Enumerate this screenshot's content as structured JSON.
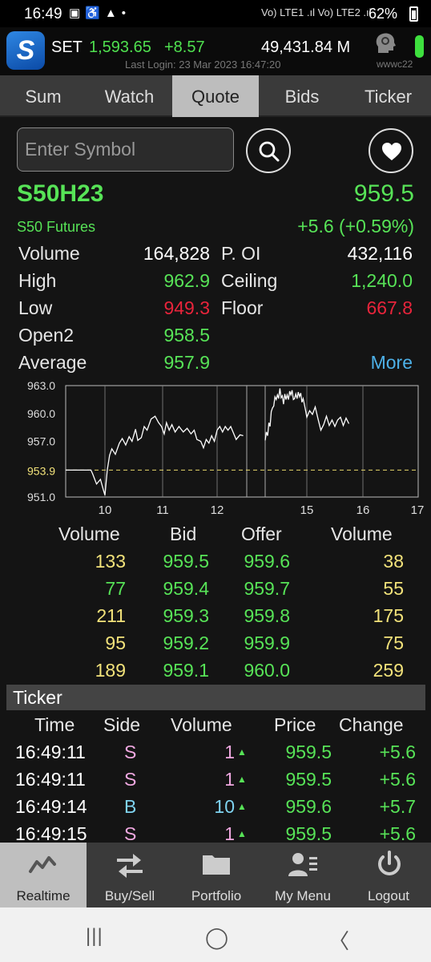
{
  "status_bar": {
    "time": "16:49",
    "notification_icons": [
      "image-icon",
      "accessibility-icon",
      "warning-icon",
      "dot-icon"
    ],
    "network": "Vo) LTE1 .ıl  Vo) LTE2 .ıl",
    "battery": "62%"
  },
  "header": {
    "app_logo": "S",
    "index_name": "SET",
    "index_value": "1,593.65",
    "index_change": "+8.57",
    "turnover": "49,431.84 M",
    "last_login": "Last Login: 23 Mar 2023 16:47:20",
    "username": "wwwc22",
    "connection_color": "#3ee03e"
  },
  "tabs": [
    "Sum",
    "Watch",
    "Quote",
    "Bids",
    "Ticker"
  ],
  "active_tab": "Quote",
  "search": {
    "placeholder": "Enter Symbol"
  },
  "quote": {
    "symbol": "S50H23",
    "name": "S50 Futures",
    "last": "959.5",
    "change": "+5.6 (+0.59%)",
    "volume_label": "Volume",
    "volume": "164,828",
    "poi_label": "P. OI",
    "poi": "432,116",
    "high_label": "High",
    "high": "962.9",
    "ceiling_label": "Ceiling",
    "ceiling": "1,240.0",
    "low_label": "Low",
    "low": "949.3",
    "floor_label": "Floor",
    "floor": "667.8",
    "open2_label": "Open2",
    "open2": "958.5",
    "average_label": "Average",
    "average": "957.9",
    "more_label": "More"
  },
  "chart_data": {
    "type": "line",
    "y_ticks": [
      "963.0",
      "960.0",
      "957.0",
      "951.0"
    ],
    "prior_close": 953.9,
    "prior_close_label": "953.9",
    "x_ticks": [
      "10",
      "11",
      "12",
      "15",
      "16",
      "17"
    ],
    "ylim": [
      951.0,
      963.0
    ],
    "xlim": [
      9.3,
      17.0
    ],
    "grid": true,
    "segments": [
      [
        [
          9.3,
          953.9
        ],
        [
          9.75,
          953.9
        ],
        [
          9.78,
          953.5
        ],
        [
          9.85,
          952.4
        ],
        [
          9.92,
          952.9
        ],
        [
          9.97,
          951.8
        ],
        [
          10.0,
          951.2
        ],
        [
          10.04,
          953.9
        ],
        [
          10.08,
          955.5
        ],
        [
          10.12,
          956.2
        ],
        [
          10.18,
          955.6
        ],
        [
          10.25,
          956.8
        ],
        [
          10.3,
          957.3
        ],
        [
          10.36,
          956.6
        ],
        [
          10.42,
          957.5
        ],
        [
          10.47,
          957.0
        ],
        [
          10.53,
          958.3
        ],
        [
          10.57,
          957.1
        ],
        [
          10.63,
          957.4
        ],
        [
          10.68,
          958.6
        ],
        [
          10.73,
          958.2
        ],
        [
          10.8,
          959.4
        ],
        [
          10.87,
          959.7
        ],
        [
          10.93,
          959.0
        ],
        [
          10.98,
          958.6
        ],
        [
          11.03,
          957.8
        ],
        [
          11.07,
          959.0
        ],
        [
          11.12,
          958.2
        ],
        [
          11.17,
          958.8
        ],
        [
          11.23,
          958.0
        ],
        [
          11.3,
          958.6
        ],
        [
          11.38,
          958.0
        ],
        [
          11.45,
          958.4
        ],
        [
          11.52,
          957.8
        ],
        [
          11.58,
          958.2
        ],
        [
          11.63,
          957.2
        ],
        [
          11.7,
          957.0
        ],
        [
          11.75,
          956.3
        ],
        [
          11.8,
          957.2
        ],
        [
          11.85,
          956.8
        ],
        [
          11.9,
          957.6
        ],
        [
          11.95,
          957.0
        ],
        [
          12.0,
          958.2
        ],
        [
          12.05,
          958.6
        ],
        [
          12.1,
          958.0
        ],
        [
          12.15,
          958.6
        ],
        [
          12.2,
          958.2
        ],
        [
          12.25,
          958.6
        ],
        [
          12.3,
          957.9
        ],
        [
          12.35,
          957.2
        ],
        [
          12.42,
          957.7
        ],
        [
          12.48,
          957.6
        ]
      ],
      [
        [
          13.3,
          957.1
        ],
        [
          13.35,
          958.0
        ],
        [
          13.4,
          957.6
        ],
        [
          13.45,
          959.0
        ],
        [
          13.5,
          958.6
        ],
        [
          13.55,
          960.2
        ],
        [
          13.6,
          960.6
        ],
        [
          13.65,
          960.8
        ],
        [
          13.7,
          961.8
        ],
        [
          13.75,
          961.5
        ],
        [
          13.8,
          962.0
        ],
        [
          13.85,
          961.6
        ],
        [
          13.9,
          962.7
        ],
        [
          13.95,
          961.7
        ],
        [
          14.0,
          961.9
        ],
        [
          14.05,
          961.0
        ],
        [
          14.1,
          962.1
        ],
        [
          14.15,
          961.5
        ],
        [
          14.2,
          962.0
        ],
        [
          14.25,
          961.5
        ],
        [
          14.3,
          962.4
        ],
        [
          14.35,
          962.0
        ],
        [
          14.4,
          962.5
        ],
        [
          14.45,
          961.5
        ],
        [
          14.5,
          961.6
        ],
        [
          14.55,
          962.1
        ],
        [
          14.6,
          961.6
        ],
        [
          14.65,
          962.3
        ],
        [
          14.7,
          961.8
        ],
        [
          14.75,
          962.2
        ],
        [
          14.8,
          961.2
        ],
        [
          14.85,
          961.6
        ],
        [
          14.9,
          961.0
        ],
        [
          14.95,
          960.3
        ],
        [
          15.0,
          959.6
        ],
        [
          15.05,
          960.3
        ],
        [
          15.1,
          959.9
        ],
        [
          15.15,
          960.7
        ],
        [
          15.2,
          959.4
        ],
        [
          15.25,
          958.2
        ],
        [
          15.3,
          958.8
        ],
        [
          15.35,
          959.7
        ],
        [
          15.4,
          958.7
        ],
        [
          15.45,
          959.3
        ],
        [
          15.5,
          958.6
        ],
        [
          15.55,
          959.3
        ],
        [
          15.6,
          959.6
        ],
        [
          15.65,
          958.7
        ],
        [
          15.7,
          959.5
        ],
        [
          15.75,
          958.9
        ]
      ]
    ]
  },
  "bids": {
    "headers": [
      "Volume",
      "Bid",
      "Offer",
      "Volume"
    ],
    "rows": [
      {
        "bid_vol": "133",
        "bid": "959.5",
        "offer": "959.6",
        "offer_vol": "38",
        "bid_vol_color": "#f2e27a",
        "offer_vol_color": "#f2e27a"
      },
      {
        "bid_vol": "77",
        "bid": "959.4",
        "offer": "959.7",
        "offer_vol": "55",
        "bid_vol_color": "#57e357",
        "offer_vol_color": "#f2e27a"
      },
      {
        "bid_vol": "211",
        "bid": "959.3",
        "offer": "959.8",
        "offer_vol": "175",
        "bid_vol_color": "#f2e27a",
        "offer_vol_color": "#f2e27a"
      },
      {
        "bid_vol": "95",
        "bid": "959.2",
        "offer": "959.9",
        "offer_vol": "75",
        "bid_vol_color": "#f2e27a",
        "offer_vol_color": "#f2e27a"
      },
      {
        "bid_vol": "189",
        "bid": "959.1",
        "offer": "960.0",
        "offer_vol": "259",
        "bid_vol_color": "#f2e27a",
        "offer_vol_color": "#f2e27a"
      }
    ]
  },
  "ticker": {
    "title": "Ticker",
    "headers": [
      "Time",
      "Side",
      "Volume",
      "Price",
      "Change"
    ],
    "rows": [
      {
        "time": "16:49:11",
        "side": "S",
        "volume": "1",
        "arrow": "▲",
        "price": "959.5",
        "change": "+5.6",
        "side_color": "#f0a8e0",
        "volume_color": "#f0a8e0"
      },
      {
        "time": "16:49:11",
        "side": "S",
        "volume": "1",
        "arrow": "▲",
        "price": "959.5",
        "change": "+5.6",
        "side_color": "#f0a8e0",
        "volume_color": "#f0a8e0"
      },
      {
        "time": "16:49:14",
        "side": "B",
        "volume": "10",
        "arrow": "▲",
        "price": "959.6",
        "change": "+5.7",
        "side_color": "#7fd3f0",
        "volume_color": "#7fd3f0"
      },
      {
        "time": "16:49:15",
        "side": "S",
        "volume": "1",
        "arrow": "▲",
        "price": "959.5",
        "change": "+5.6",
        "side_color": "#f0a8e0",
        "volume_color": "#f0a8e0"
      }
    ]
  },
  "bottom_nav": [
    {
      "label": "Realtime",
      "icon": "realtime-chart-icon",
      "active": true
    },
    {
      "label": "Buy/Sell",
      "icon": "buy-sell-arrows-icon",
      "active": false
    },
    {
      "label": "Portfolio",
      "icon": "folder-icon",
      "active": false
    },
    {
      "label": "My Menu",
      "icon": "user-menu-icon",
      "active": false
    },
    {
      "label": "Logout",
      "icon": "power-icon",
      "active": false
    }
  ],
  "system_nav": {
    "recents": "|||",
    "home": "◯",
    "back": "〈"
  }
}
